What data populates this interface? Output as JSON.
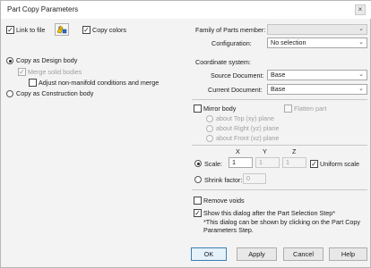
{
  "window": {
    "title": "Part Copy Parameters",
    "close_glyph": "×"
  },
  "left": {
    "link_to_file": {
      "label": "Link to file",
      "checked": true
    },
    "copy_colors": {
      "label": "Copy colors",
      "checked": true
    },
    "copy_as_design": {
      "label": "Copy as Design body",
      "selected": true
    },
    "merge_solid_bodies": {
      "label": "Merge solid bodies",
      "checked": true,
      "disabled": true
    },
    "adjust_non_manifold": {
      "label": "Adjust non-manifold conditions and merge",
      "checked": false
    },
    "copy_as_construction": {
      "label": "Copy as Construction body",
      "selected": false
    }
  },
  "right": {
    "family_label": "Family of Parts member:",
    "family_value": "",
    "configuration_label": "Configuration:",
    "configuration_value": "No selection",
    "coordinate_system_heading": "Coordinate system:",
    "source_doc_label": "Source Document:",
    "source_doc_value": "Base",
    "current_doc_label": "Current Document:",
    "current_doc_value": "Base",
    "mirror_body": {
      "label": "Mirror body",
      "checked": false
    },
    "flatten_part": {
      "label": "Flatten part",
      "checked": false
    },
    "mirror_planes": [
      "about Top (xy) plane",
      "about Right (yz) plane",
      "about Front (xz) plane"
    ],
    "axis_headers": [
      "X",
      "Y",
      "Z"
    ],
    "scale": {
      "label": "Scale:",
      "selected": true,
      "x": "1",
      "y": "1",
      "z": "1"
    },
    "uniform_scale": {
      "label": "Uniform scale",
      "checked": true
    },
    "shrink": {
      "label": "Shrink factor:",
      "selected": false,
      "value": "0"
    },
    "remove_voids": {
      "label": "Remove voids",
      "checked": false
    },
    "show_dialog": {
      "label": "Show this dialog after the Part Selection Step*",
      "checked": true
    },
    "note": [
      "*This dialog can be shown by clicking on the Part Copy",
      "Parameters Step."
    ]
  },
  "buttons": {
    "ok": "OK",
    "apply": "Apply",
    "cancel": "Cancel",
    "help": "Help"
  },
  "icons": {
    "part_icon": "part-copy-icon",
    "check_glyph": "✓",
    "chevron_glyph": "⌄"
  },
  "colors": {
    "dialog_bg": "#f3f3f3",
    "default_button_border": "#3c7fb1",
    "part_icon_yellow": "#f2c200",
    "part_icon_blue": "#2b6cc4"
  }
}
